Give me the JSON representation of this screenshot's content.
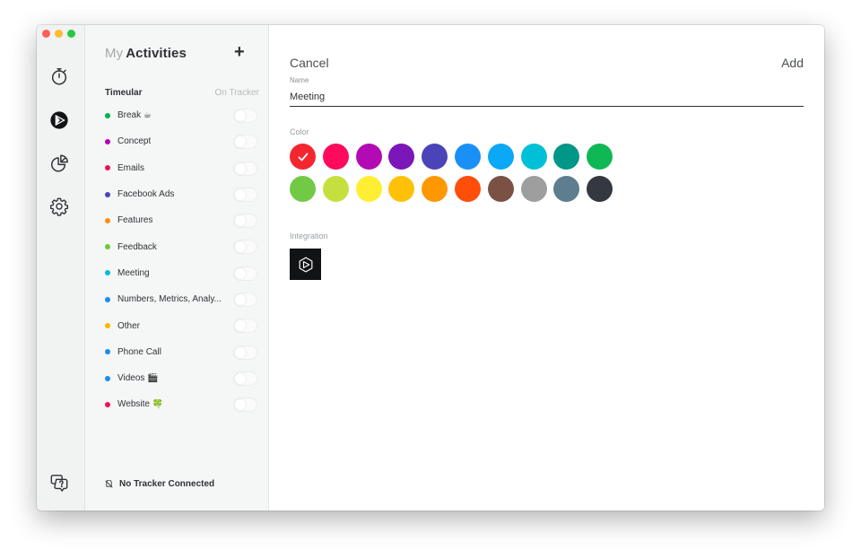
{
  "sidebar": {
    "title_prefix": "My",
    "title_main": "Activities",
    "add_label": "+",
    "group_name": "Timeular",
    "group_column": "On Tracker",
    "items": [
      {
        "label": "Break ☕",
        "color": "#00b050"
      },
      {
        "label": "Concept",
        "color": "#b000b8"
      },
      {
        "label": "Emails",
        "color": "#f0105a"
      },
      {
        "label": "Facebook Ads",
        "color": "#4a44b8"
      },
      {
        "label": "Features",
        "color": "#ff8c10"
      },
      {
        "label": "Feedback",
        "color": "#6cc93a"
      },
      {
        "label": "Meeting",
        "color": "#00bcd4"
      },
      {
        "label": "Numbers, Metrics, Analy...",
        "color": "#1a8cf0"
      },
      {
        "label": "Other",
        "color": "#ffb400"
      },
      {
        "label": "Phone Call",
        "color": "#1a8cf0"
      },
      {
        "label": "Videos 🎬",
        "color": "#1a8cf0"
      },
      {
        "label": "Website 🍀",
        "color": "#f0105a"
      }
    ],
    "footer_text": "No Tracker Connected"
  },
  "rail": {
    "icons": [
      "stopwatch-icon",
      "timeular-logo-icon",
      "pie-chart-icon",
      "gear-icon",
      "help-chat-icon"
    ]
  },
  "form": {
    "cancel_label": "Cancel",
    "add_label": "Add",
    "name_label": "Name",
    "name_value": "Meeting",
    "color_label": "Color",
    "integration_label": "Integration",
    "selected_color_index": 0,
    "colors": [
      "#f4262f",
      "#ff0a5c",
      "#b30bb3",
      "#7b16b8",
      "#4b43b8",
      "#1890f5",
      "#0aa8f5",
      "#00c0d8",
      "#009688",
      "#10b855",
      "#72c946",
      "#c5e03e",
      "#ffee33",
      "#ffc107",
      "#ff9800",
      "#ff4d0a",
      "#7b5146",
      "#9e9e9e",
      "#5e7d8e",
      "#33393e"
    ]
  }
}
